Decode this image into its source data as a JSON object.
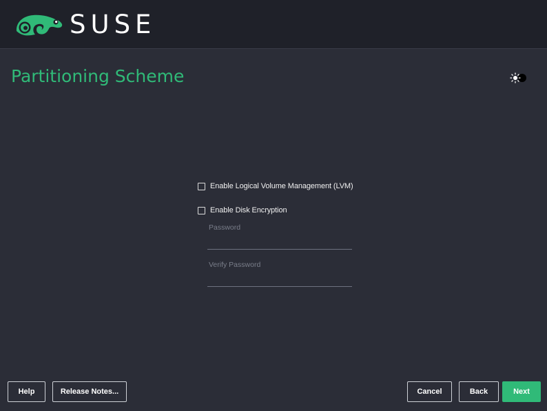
{
  "header": {
    "logo_text": "SUSE",
    "logo_icon": "chameleon-icon"
  },
  "page": {
    "title": "Partitioning Scheme",
    "theme_toggle_icon": "sun-moon-icon"
  },
  "form": {
    "lvm_label": "Enable Logical Volume Management (LVM)",
    "lvm_checked": false,
    "encryption_label": "Enable Disk Encryption",
    "encryption_checked": false,
    "password_label": "Password",
    "password_value": "",
    "verify_password_label": "Verify Password",
    "verify_password_value": ""
  },
  "buttons": {
    "help": "Help",
    "release_notes": "Release Notes...",
    "cancel": "Cancel",
    "back": "Back",
    "next": "Next"
  },
  "colors": {
    "accent": "#30ba78",
    "background": "#2b2d37",
    "header_background": "#1f2129"
  }
}
